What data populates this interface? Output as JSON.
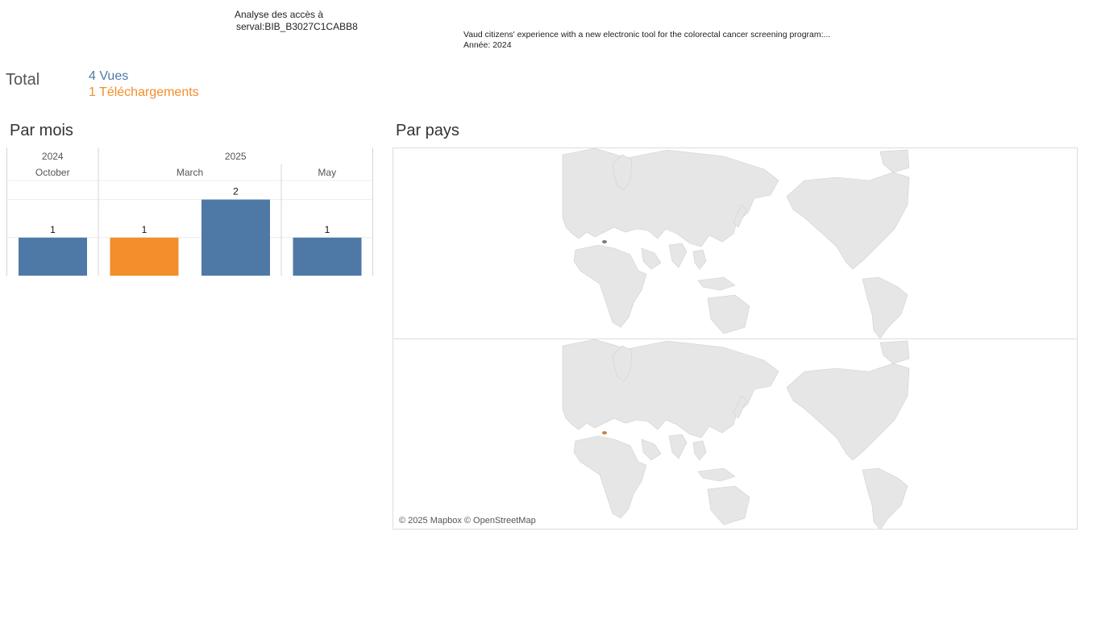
{
  "header": {
    "title_line1": "Analyse des accès à",
    "title_line2": "serval:BIB_B3027C1CABB8"
  },
  "publication": {
    "title": "Vaud citizens' experience with a new electronic tool for the colorectal cancer screening program:...",
    "year_line": "Année: 2024"
  },
  "totals": {
    "label": "Total",
    "views": "4 Vues",
    "downloads": "1 Téléchargements"
  },
  "colors": {
    "views": "#4e79a7",
    "downloads": "#f28e2b",
    "land": "#e6e6e6",
    "highlight": "#7a7a7a"
  },
  "sections": {
    "by_month": "Par mois",
    "by_country": "Par pays"
  },
  "chart_data": {
    "type": "bar",
    "title": "Par mois",
    "years": [
      "2024",
      "2025"
    ],
    "months": [
      {
        "year": "2024",
        "month": "October"
      },
      {
        "year": "2025",
        "month": "March"
      },
      {
        "year": "2025",
        "month": "May"
      }
    ],
    "bars": [
      {
        "year": "2024",
        "month": "October",
        "type": "views",
        "value": 1
      },
      {
        "year": "2025",
        "month": "March",
        "type": "downloads",
        "value": 1
      },
      {
        "year": "2025",
        "month": "March",
        "type": "views",
        "value": 2
      },
      {
        "year": "2025",
        "month": "May",
        "type": "views",
        "value": 1
      }
    ],
    "ylim": [
      0,
      2.5
    ],
    "grid": true
  },
  "map": {
    "attribution": "© 2025 Mapbox © OpenStreetMap",
    "panels": [
      {
        "metric": "views",
        "highlight_country": "Switzerland"
      },
      {
        "metric": "downloads",
        "highlight_country": "Switzerland"
      }
    ]
  }
}
